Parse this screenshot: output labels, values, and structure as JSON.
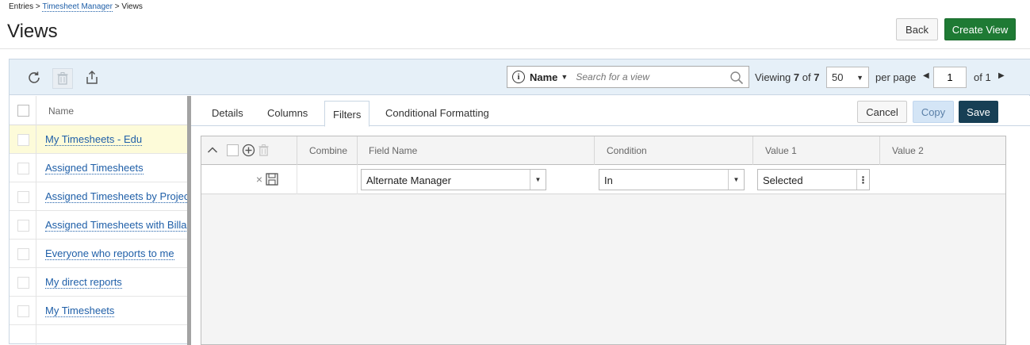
{
  "breadcrumb": {
    "entries": "Entries",
    "sep1": ">",
    "timesheet_manager": "Timesheet Manager",
    "sep2": ">",
    "views": "Views"
  },
  "page_title": "Views",
  "header_buttons": {
    "back": "Back",
    "create_view": "Create View"
  },
  "toolbar": {
    "icons": [
      "refresh-icon",
      "trash-icon",
      "export-icon"
    ],
    "search": {
      "field": "Name",
      "placeholder": "Search for a view"
    },
    "viewing_label": "Viewing",
    "viewing_count": "7",
    "viewing_of": "of",
    "viewing_total": "7",
    "per_page_value": "50",
    "per_page_label": "per page",
    "page_number": "1",
    "page_of": "of 1"
  },
  "list": {
    "header_name": "Name",
    "items": [
      {
        "label": "My Timesheets - Edu"
      },
      {
        "label": "Assigned Timesheets"
      },
      {
        "label": "Assigned Timesheets by Project"
      },
      {
        "label": "Assigned Timesheets with Billable"
      },
      {
        "label": "Everyone who reports to me"
      },
      {
        "label": "My direct reports"
      },
      {
        "label": "My Timesheets"
      }
    ]
  },
  "detail": {
    "tabs": [
      "Details",
      "Columns",
      "Filters",
      "Conditional Formatting"
    ],
    "active_tab": "Filters",
    "buttons": {
      "cancel": "Cancel",
      "copy": "Copy",
      "save": "Save"
    },
    "filters": {
      "columns": [
        "Combine",
        "Field Name",
        "Condition",
        "Value 1",
        "Value 2"
      ],
      "rows": [
        {
          "combine": "",
          "field_name": "Alternate Manager",
          "condition": "In",
          "value1": "Selected",
          "value2": ""
        }
      ]
    }
  },
  "colors": {
    "create_button": "#1e7a34",
    "save_button": "#173f55",
    "copy_button": "#d4e5f6",
    "link": "#1f5fa8",
    "toolbar_bg": "#e6f0f8",
    "selected_row": "#fdfbd9"
  }
}
